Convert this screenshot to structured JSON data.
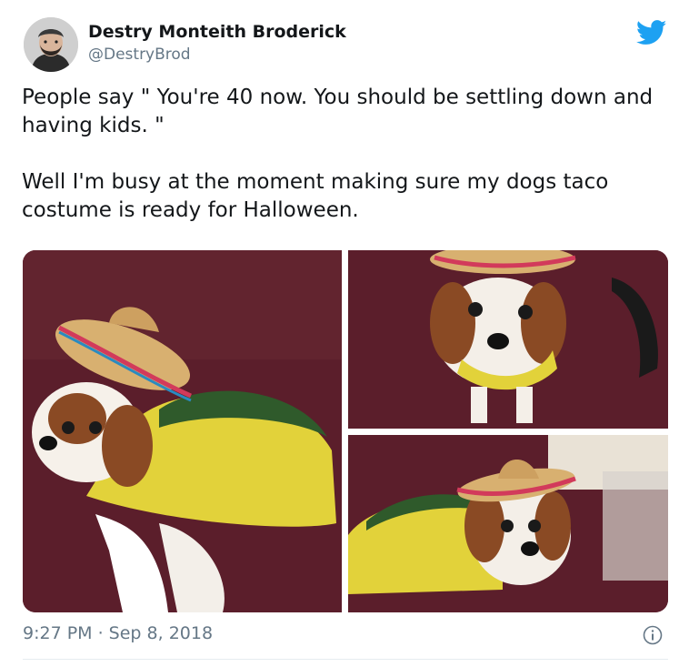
{
  "tweet": {
    "author_name": "Destry Monteith Broderick",
    "author_handle": "@DestryBrod",
    "text": "People say \" You're 40 now. You should be settling down and having kids. \"\n\nWell I'm busy at the moment making sure my dogs taco costume is ready for Halloween.",
    "timestamp": "9:27 PM · Sep 8, 2018"
  },
  "icons": {
    "brand": "twitter-bird-icon",
    "info": "info-icon"
  },
  "colors": {
    "twitter_blue": "#1da1f2",
    "secondary_text": "#657786",
    "carpet": "#5a1f2a",
    "taco_yellow": "#e4d43c",
    "lettuce_green": "#2f5a2b"
  }
}
